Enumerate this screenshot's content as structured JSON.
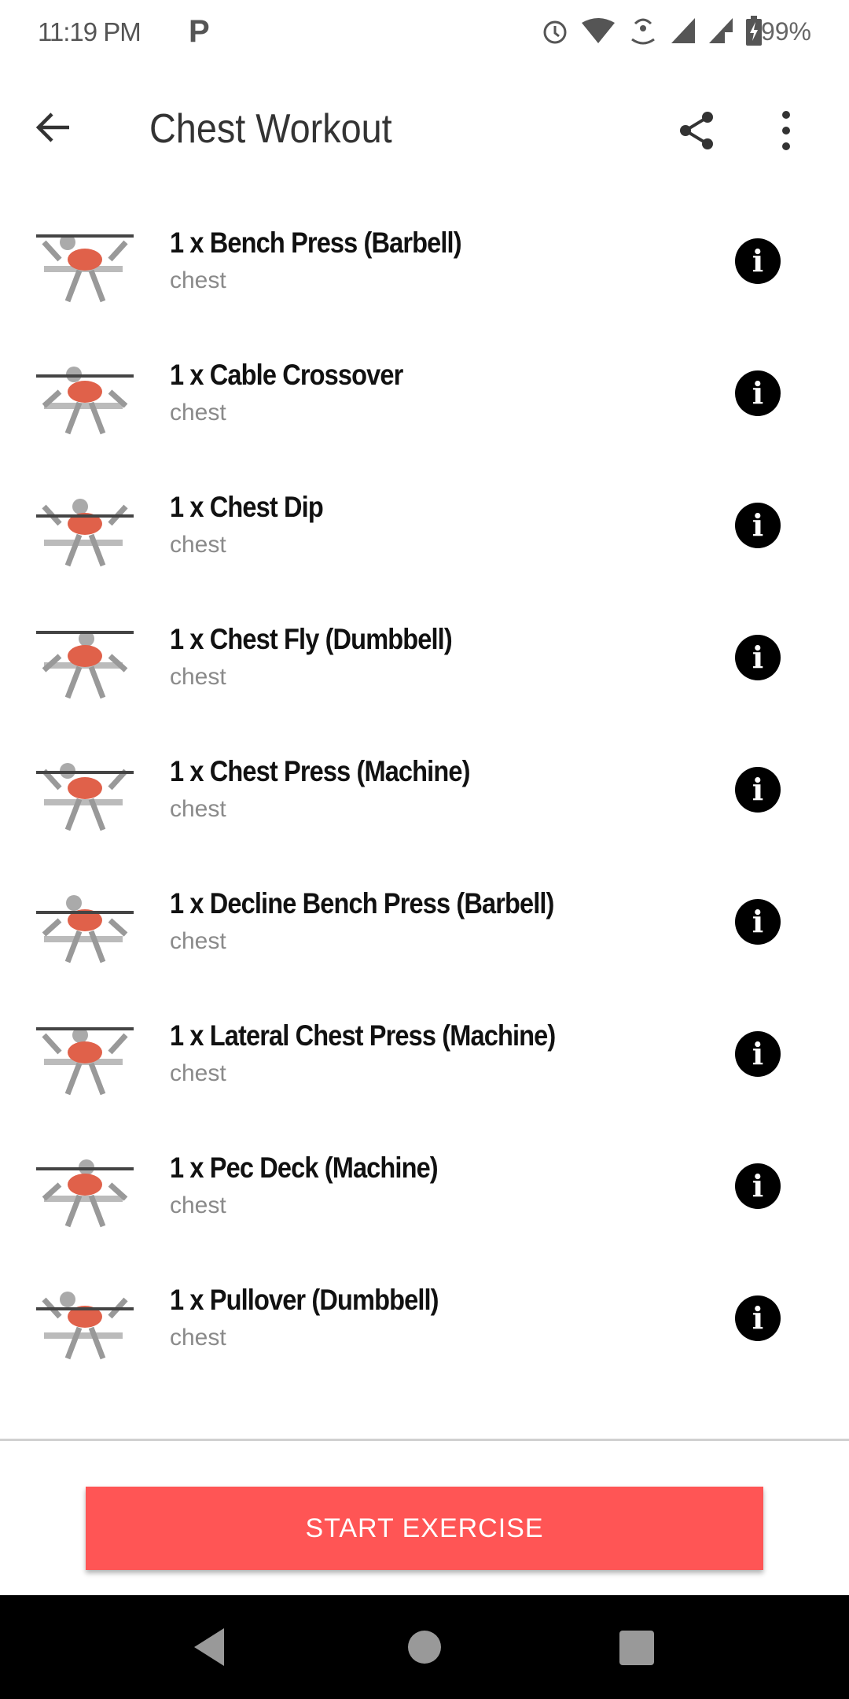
{
  "status_bar": {
    "time": "11:19 PM",
    "notification": "P",
    "battery": "99%",
    "icons": [
      "alarm-icon",
      "wifi-icon",
      "hotspot-icon",
      "signal-icon",
      "signal-no-sim-icon",
      "battery-charging-icon"
    ]
  },
  "toolbar": {
    "title": "Chest Workout",
    "back_icon": "arrow-left-icon",
    "share_icon": "share-icon",
    "more_icon": "more-vert-icon"
  },
  "exercises": [
    {
      "name": "1 x Bench Press (Barbell)",
      "muscle": "chest"
    },
    {
      "name": "1 x Cable Crossover",
      "muscle": "chest"
    },
    {
      "name": "1 x Chest Dip",
      "muscle": "chest"
    },
    {
      "name": "1 x Chest Fly (Dumbbell)",
      "muscle": "chest"
    },
    {
      "name": "1 x Chest Press (Machine)",
      "muscle": "chest"
    },
    {
      "name": "1 x Decline Bench Press (Barbell)",
      "muscle": "chest"
    },
    {
      "name": "1 x Lateral Chest Press (Machine)",
      "muscle": "chest"
    },
    {
      "name": "1 x Pec Deck (Machine)",
      "muscle": "chest"
    },
    {
      "name": "1 x Pullover (Dumbbell)",
      "muscle": "chest"
    }
  ],
  "info_glyph": "i",
  "start_button": "START EXERCISE",
  "colors": {
    "accent": "#ff5555",
    "muscle_highlight": "#e0614a"
  }
}
